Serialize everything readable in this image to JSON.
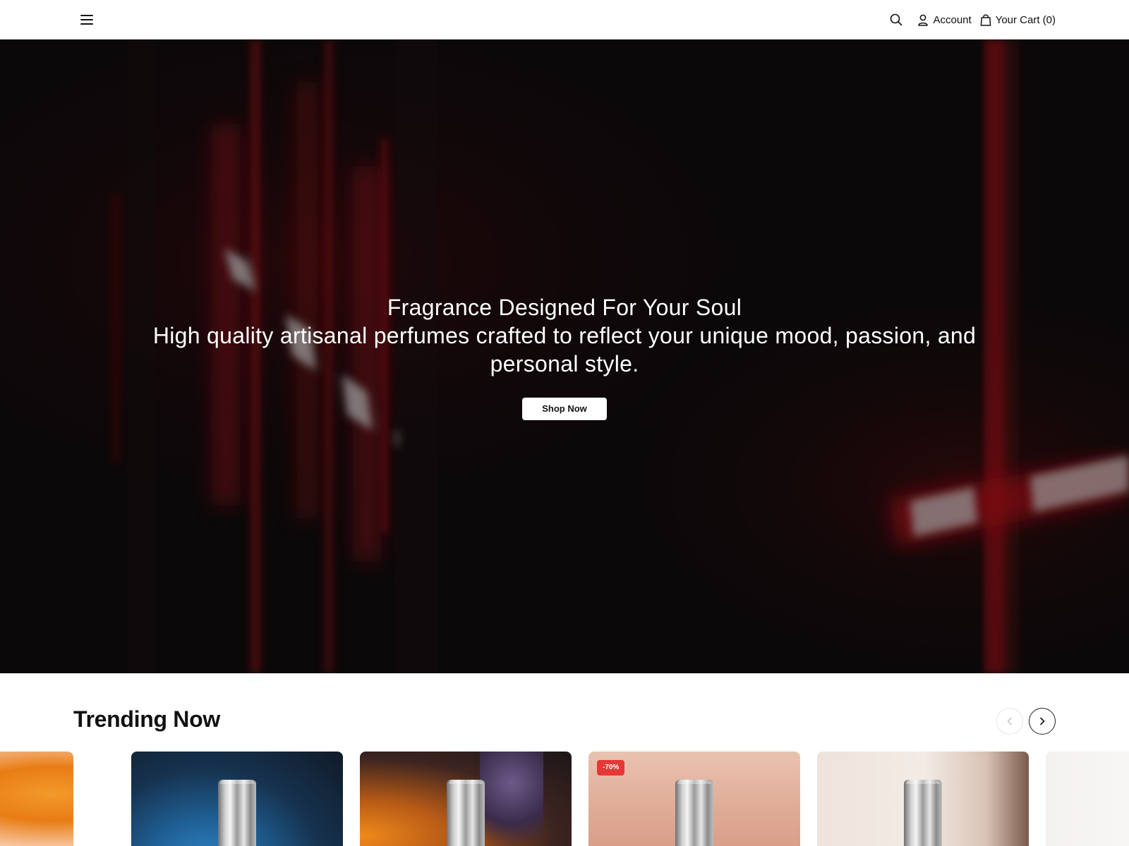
{
  "header": {
    "menu_icon": "hamburger-menu-icon",
    "search_icon": "search-icon",
    "account_label": "Account",
    "account_icon": "user-icon",
    "cart_label": "Your Cart (0)",
    "cart_icon": "shopping-bag-icon"
  },
  "hero": {
    "title": "Fragrance Designed For Your Soul",
    "subtitle": "High quality artisanal perfumes crafted to reflect your unique mood, passion, and personal style.",
    "cta_label": "Shop Now"
  },
  "trending": {
    "title": "Trending Now",
    "prev_icon": "chevron-left-icon",
    "next_icon": "chevron-right-icon",
    "products": [
      {
        "image": "orange-citrus-background",
        "badge": ""
      },
      {
        "image": "blue-dark-background-bottle",
        "badge": ""
      },
      {
        "image": "orange-lavender-background-bottle",
        "badge": ""
      },
      {
        "image": "peach-background-bottle",
        "badge": "-70%"
      },
      {
        "image": "cream-background-bottle",
        "badge": ""
      }
    ]
  },
  "colors": {
    "sale_badge": "#e53935",
    "hero_accent_red": "#d0142a"
  }
}
